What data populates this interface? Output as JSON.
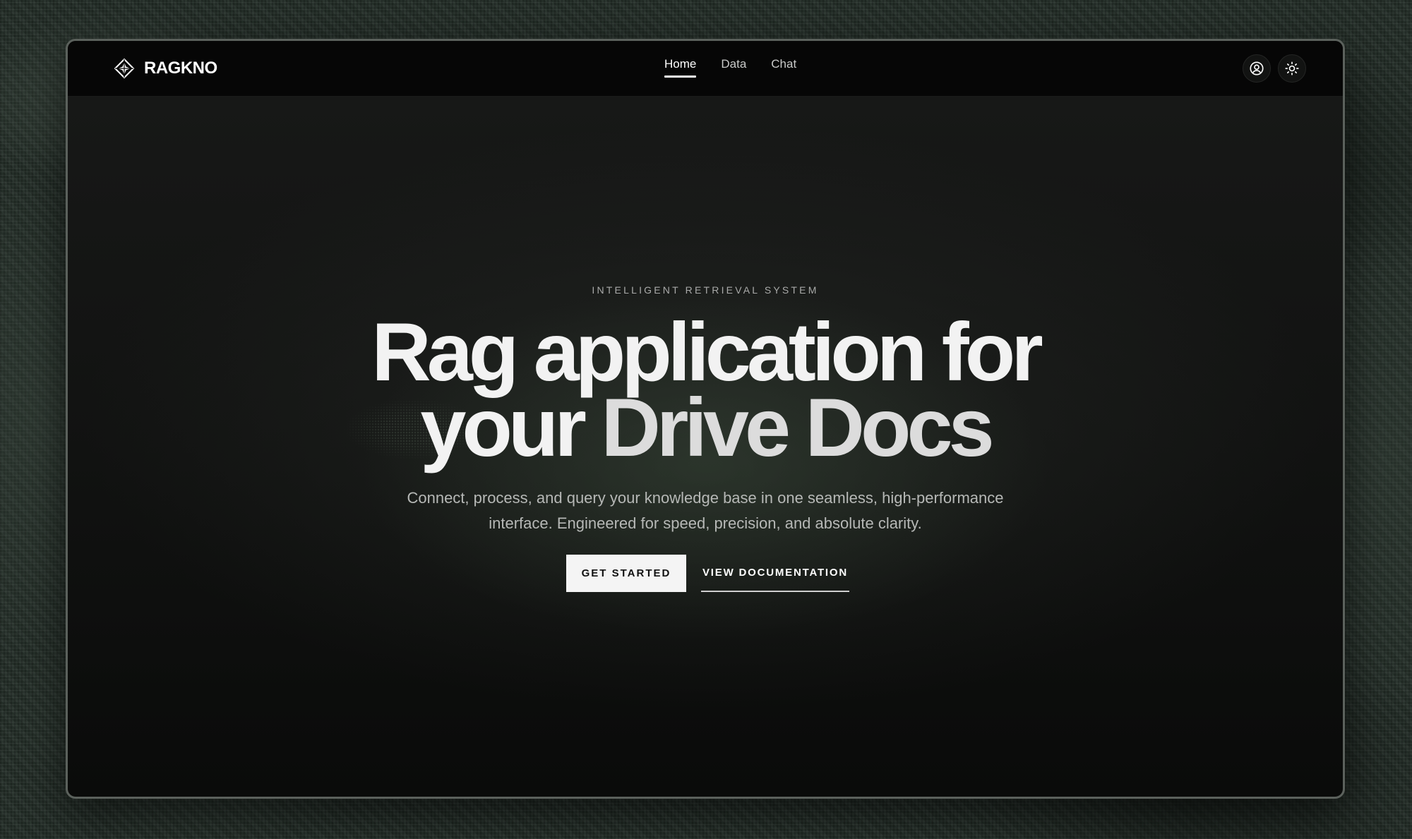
{
  "brand": {
    "name": "RAGKNO",
    "logo_icon": "diamond-compass-icon"
  },
  "nav": {
    "items": [
      {
        "label": "Home",
        "active": true
      },
      {
        "label": "Data",
        "active": false
      },
      {
        "label": "Chat",
        "active": false
      }
    ]
  },
  "header_actions": {
    "user_icon": "user-circle-icon",
    "theme_icon": "sun-icon"
  },
  "hero": {
    "eyebrow": "INTELLIGENT RETRIEVAL SYSTEM",
    "headline_line1": "Rag application for",
    "headline_line2_part1": "your ",
    "headline_line2_part2": "Drive Docs",
    "subtitle_line1": "Connect, process, and query your knowledge base in one seamless, high-performance",
    "subtitle_line2": "interface. Engineered for speed, precision, and absolute clarity.",
    "primary_cta": "GET STARTED",
    "secondary_cta": "VIEW DOCUMENTATION"
  },
  "colors": {
    "page_background": "#26302a",
    "window_background": "#111211",
    "navbar_background": "#060606",
    "text_primary": "#ffffff",
    "text_muted": "#b6b8b6",
    "primary_button_bg": "#f4f4f4",
    "primary_button_text": "#111111"
  }
}
